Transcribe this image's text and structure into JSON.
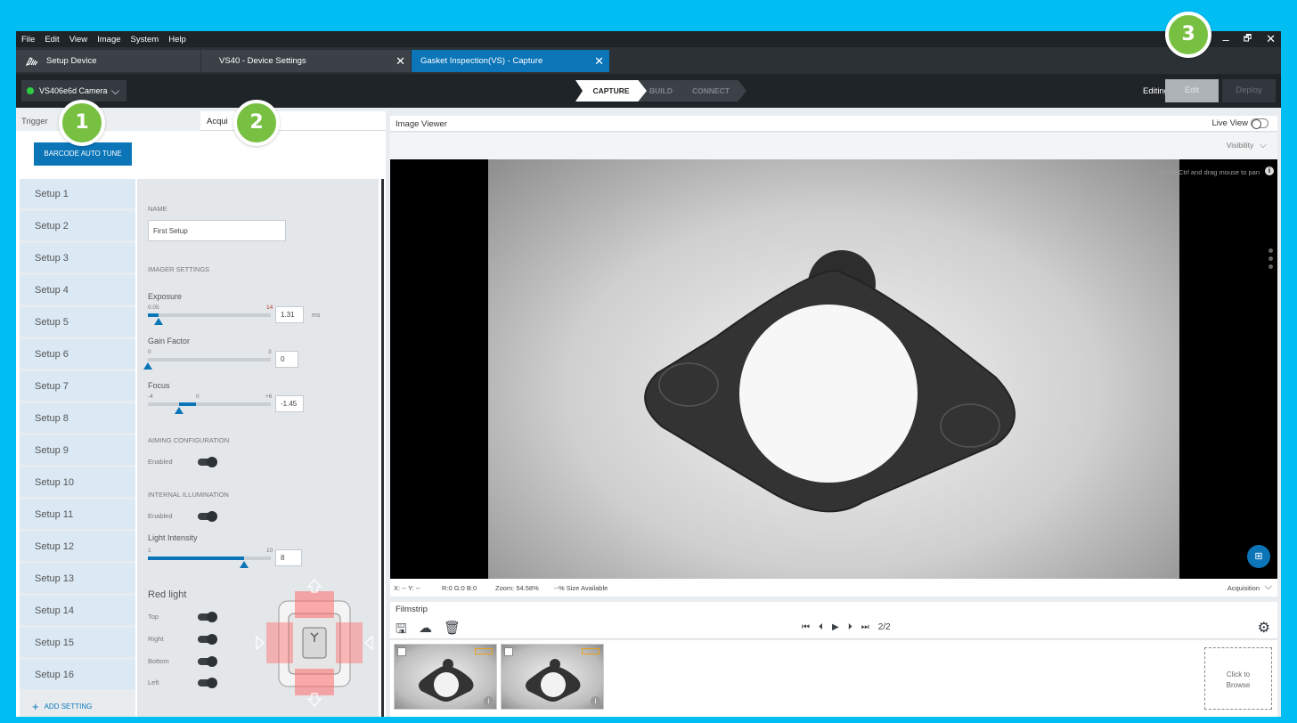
{
  "menu": [
    "File",
    "Edit",
    "View",
    "Image",
    "System",
    "Help"
  ],
  "window_controls": {
    "minimize": "–",
    "restore": "🗗",
    "close": "✕"
  },
  "tabs": [
    {
      "label": "Setup Device"
    },
    {
      "label": "VS40 - Device Settings",
      "close": "✕"
    },
    {
      "label": "Gasket Inspection(VS) - Capture",
      "close": "✕"
    }
  ],
  "toolbar": {
    "camera": "VS406e6d Camera",
    "steps": [
      "CAPTURE",
      "BUILD",
      "CONNECT"
    ],
    "editing_label": "Editing",
    "edit_button": "Edit",
    "deploy_button": "Deploy"
  },
  "left_panel": {
    "tab_triggers": "Trigger",
    "tab_acquisition": "Acqui",
    "autotune_button": "BARCODE AUTO TUNE",
    "setups": [
      "Setup 1",
      "Setup 2",
      "Setup 3",
      "Setup 4",
      "Setup 5",
      "Setup 6",
      "Setup 7",
      "Setup 8",
      "Setup 9",
      "Setup 10",
      "Setup 11",
      "Setup 12",
      "Setup 13",
      "Setup 14",
      "Setup 15",
      "Setup 16"
    ],
    "add_setting": "ADD SETTING",
    "name_section": "NAME",
    "name_value": "First Setup",
    "imager_section": "IMAGER SETTINGS",
    "exposure": {
      "label": "Exposure",
      "min": "0.05",
      "max": "14",
      "value": "1.31",
      "unit": "ms",
      "level": 0.09
    },
    "gain": {
      "label": "Gain Factor",
      "min": "0",
      "max": "3",
      "value": "0",
      "level": 0.0
    },
    "focus": {
      "label": "Focus",
      "min": "-4",
      "mid": "0",
      "max": "+6",
      "value": "-1.45",
      "level": 0.255
    },
    "aiming_section": "AIMING CONFIGURATION",
    "aiming_enabled": "Enabled",
    "illum_section": "INTERNAL ILLUMINATION",
    "illum_enabled": "Enabled",
    "light_intensity": {
      "label": "Light Intensity",
      "min": "1",
      "max": "10",
      "value": "8",
      "level": 0.78
    },
    "red_light": {
      "label": "Red light",
      "top": "Top",
      "right": "Right",
      "bottom": "Bottom",
      "left": "Left"
    }
  },
  "viewer": {
    "title": "Image Viewer",
    "live_view": "Live View",
    "visibility": "Visibility",
    "hint": "Press Ctrl and drag mouse to pan",
    "status_xy": "X: -- Y: --",
    "status_rgb": "R:0 G:0 B:0",
    "status_zoom": "Zoom: 54.58%",
    "status_size": "--% Size Available",
    "acquisition": "Acquisition"
  },
  "filmstrip": {
    "title": "Filmstrip",
    "counter": "2/2",
    "browse": [
      "Click to",
      "Browse"
    ]
  },
  "callouts": [
    "1",
    "2",
    "3"
  ],
  "colors": {
    "accent": "#0b75b8",
    "frame": "#00bdf2",
    "callout": "#78c042",
    "status_dot": "#2ecc40"
  }
}
